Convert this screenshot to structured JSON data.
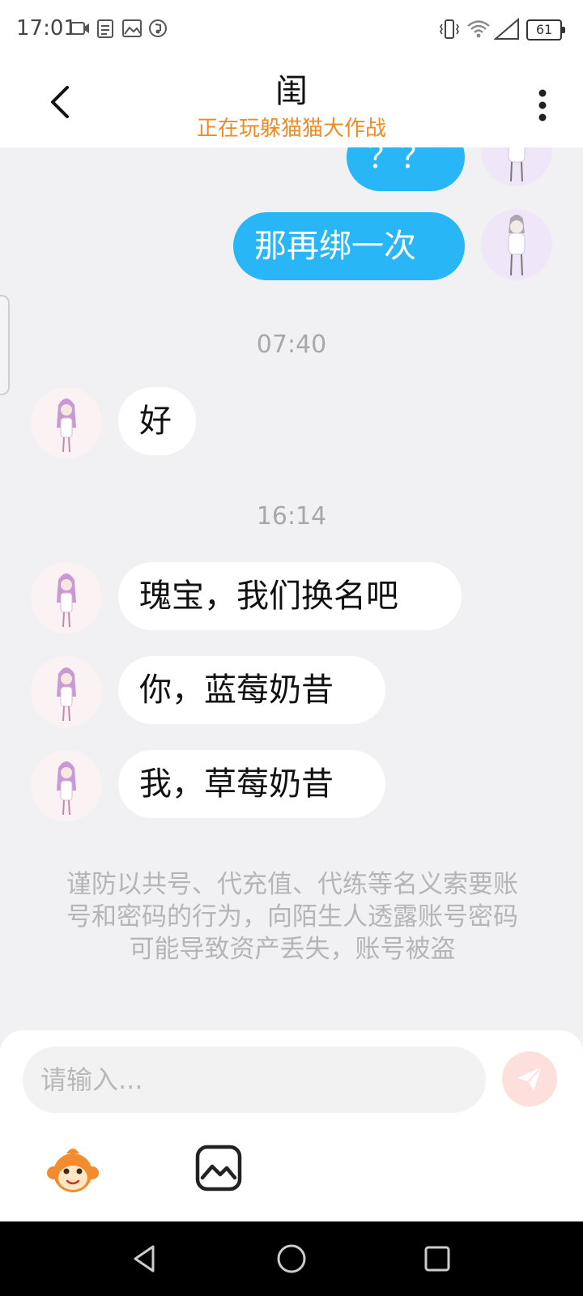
{
  "status_bar": {
    "time": "17:01",
    "battery": "61",
    "icons": [
      "video-icon",
      "notepad-icon",
      "gallery-icon",
      "music-icon",
      "vibrate-icon",
      "wifi-icon",
      "signal-icon",
      "battery-icon"
    ]
  },
  "header": {
    "title": "闺",
    "subtitle": "正在玩躲猫猫大作战",
    "subtitle_color": "#f08a24"
  },
  "messages": [
    {
      "from": "me",
      "text": "？？"
    },
    {
      "from": "me",
      "text": "那再绑一次"
    },
    {
      "type": "time",
      "text": "07:40"
    },
    {
      "from": "them",
      "text": "好"
    },
    {
      "type": "time",
      "text": "16:14"
    },
    {
      "from": "them",
      "text": "瑰宝，我们换名吧"
    },
    {
      "from": "them",
      "text": "你，蓝莓奶昔"
    },
    {
      "from": "them",
      "text": "我，草莓奶昔"
    }
  ],
  "warning": "谨防以共号、代充值、代练等名义索要账号和密码的行为，向陌生人透露账号密码可能导致资产丢失，账号被盗",
  "input": {
    "placeholder": "请输入..."
  },
  "colors": {
    "outgoing_bubble": "#28b6f6",
    "incoming_bubble": "#ffffff",
    "chat_background": "#f1f1f3",
    "send_button": "#fde0db"
  }
}
